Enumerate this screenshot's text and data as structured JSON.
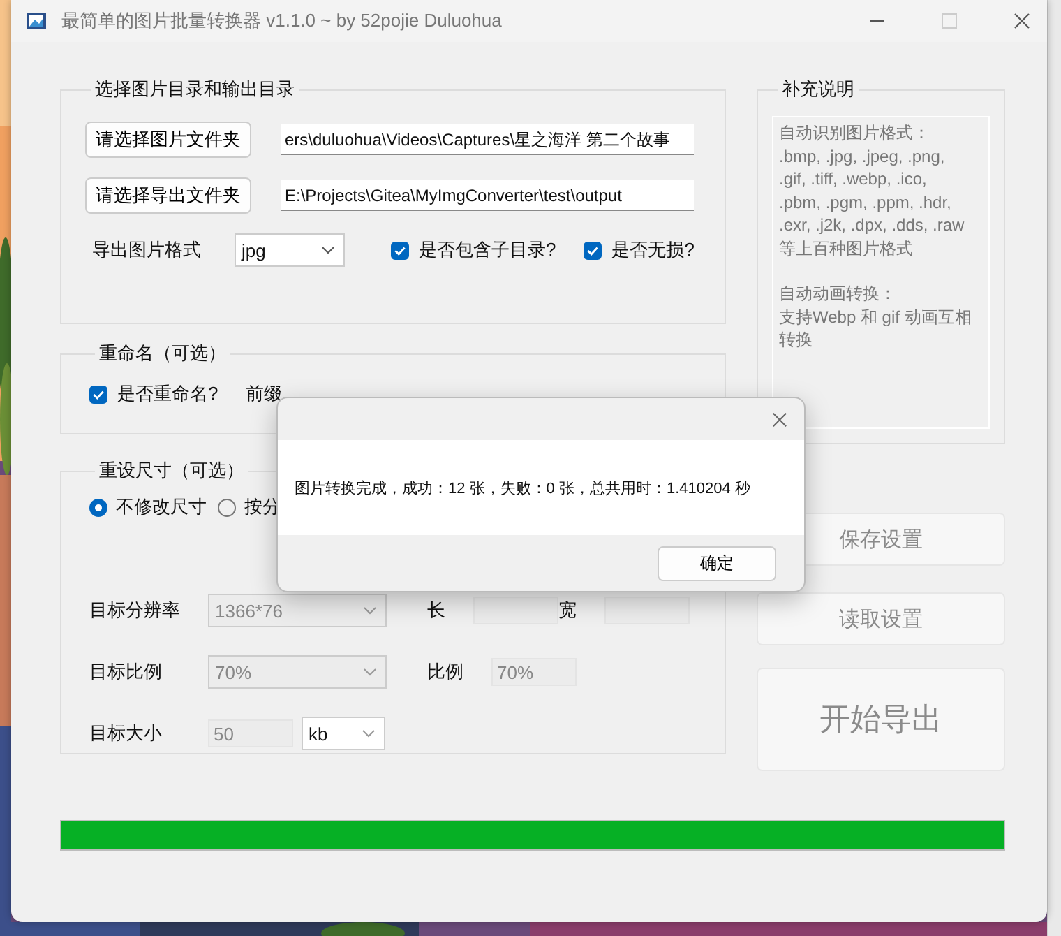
{
  "window": {
    "title": "最简单的图片批量转换器 v1.1.0 ~ by 52pojie Duluohua"
  },
  "source_group": {
    "title": "选择图片目录和输出目录",
    "input_button": "请选择图片文件夹",
    "input_path": "ers\\duluohua\\Videos\\Captures\\星之海洋 第二个故事",
    "output_button": "请选择导出文件夹",
    "output_path": "E:\\Projects\\Gitea\\MyImgConverter\\test\\output",
    "format_label": "导出图片格式",
    "format": "jpg",
    "checkboxes": [
      {
        "label": "是否包含子目录?",
        "checked": true
      },
      {
        "label": "是否无损?",
        "checked": true
      }
    ]
  },
  "rename_group": {
    "title": "重命名（可选）",
    "checkbox": {
      "label": "是否重命名?",
      "checked": true
    },
    "prefix_label": "前缀"
  },
  "resize_group": {
    "title": "重设尺寸（可选）",
    "radios": [
      {
        "label": "不修改尺寸",
        "selected": true
      },
      {
        "label": "按分",
        "selected": false
      }
    ],
    "rows": [
      {
        "label": "目标分辨率",
        "controls": [
          {
            "kind": "combo",
            "value": "1366*76",
            "disabled": true
          },
          {
            "kind": "label",
            "text": "长"
          },
          {
            "kind": "field",
            "disabled": true
          },
          {
            "kind": "label",
            "text": "宽"
          },
          {
            "kind": "field",
            "disabled": true
          }
        ]
      },
      {
        "label": "目标比例",
        "controls": [
          {
            "kind": "combo",
            "value": "70%",
            "disabled": true
          },
          {
            "kind": "label",
            "text": "比例"
          },
          {
            "kind": "field",
            "value": "70%",
            "disabled": true
          }
        ]
      },
      {
        "label": "目标大小",
        "controls": [
          {
            "kind": "field",
            "value": "50",
            "disabled": true
          },
          {
            "kind": "smallcombo",
            "value": "kb",
            "disabled": false
          }
        ]
      }
    ]
  },
  "notes_group": {
    "title": "补充说明",
    "paragraphs": [
      [
        "自动识别图片格式：",
        ".bmp, .jpg, .jpeg, .png,",
        ".gif, .tiff, .webp, .ico,",
        ".pbm, .pgm, .ppm, .hdr,",
        ".exr, .j2k, .dpx, .dds, .raw",
        "等上百种图片格式"
      ],
      [
        "自动动画转换：",
        "支持Webp 和 gif 动画互相",
        "转换"
      ]
    ]
  },
  "action_buttons": [
    {
      "label": "保存设置",
      "kind": "small",
      "disabled": true
    },
    {
      "label": "读取设置",
      "kind": "small",
      "disabled": true
    },
    {
      "label": "开始导出",
      "kind": "large",
      "disabled": true
    }
  ],
  "progress": {
    "level": 1
  },
  "dialog": {
    "message": "图片转换完成，成功：12 张，失败：0 张，总共用时：1.410204 秒",
    "ok_button": "确定"
  }
}
